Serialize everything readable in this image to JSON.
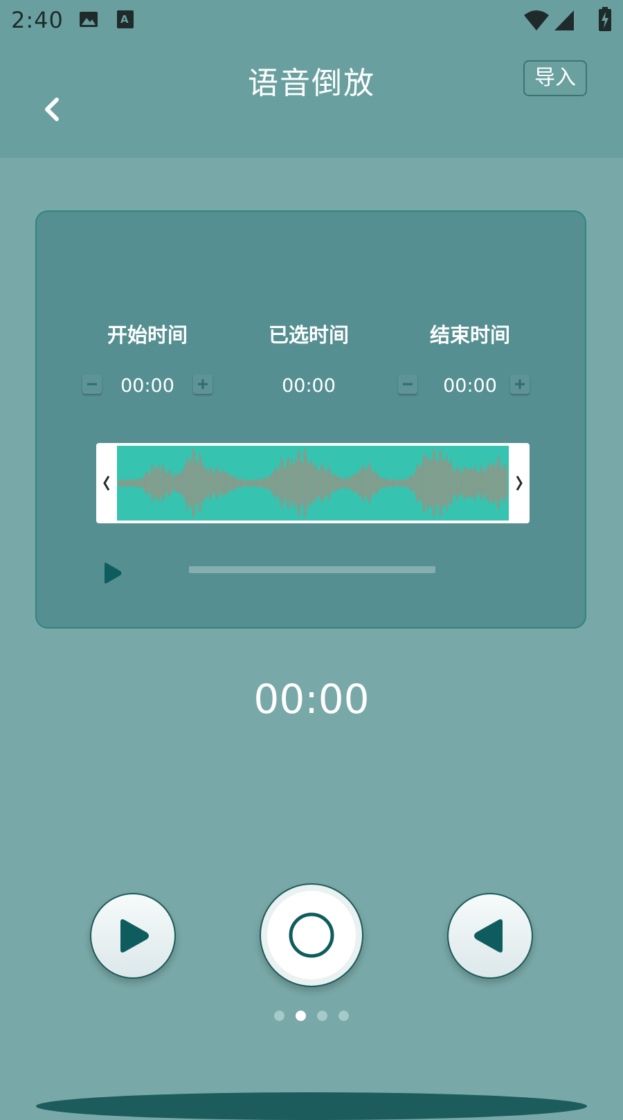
{
  "status_bar": {
    "time": "2:40",
    "icons": [
      "image-icon",
      "font-icon",
      "wifi-icon",
      "signal-icon",
      "battery-charging-icon"
    ]
  },
  "header": {
    "title": "语音倒放",
    "import_label": "导入",
    "back_icon": "chevron-left-icon"
  },
  "trim_panel": {
    "start": {
      "label": "开始时间",
      "value": "00:00"
    },
    "selected": {
      "label": "已选时间",
      "value": "00:00"
    },
    "end": {
      "label": "结束时间",
      "value": "00:00"
    },
    "waveform": {
      "left_handle": "❮",
      "right_handle": "❯"
    },
    "preview_progress": 0
  },
  "timer": "00:00",
  "controls": {
    "play_icon": "play-icon",
    "record_icon": "record-icon",
    "reverse_icon": "reverse-play-icon"
  },
  "pager": {
    "count": 4,
    "active_index": 1
  },
  "colors": {
    "background": "#78a8a7",
    "header": "#69a09f",
    "card": "#558f91",
    "accent_dark": "#1d5a5b",
    "waveform_fill": "#36c3b0",
    "waveform_lines": "#c97b6e"
  }
}
